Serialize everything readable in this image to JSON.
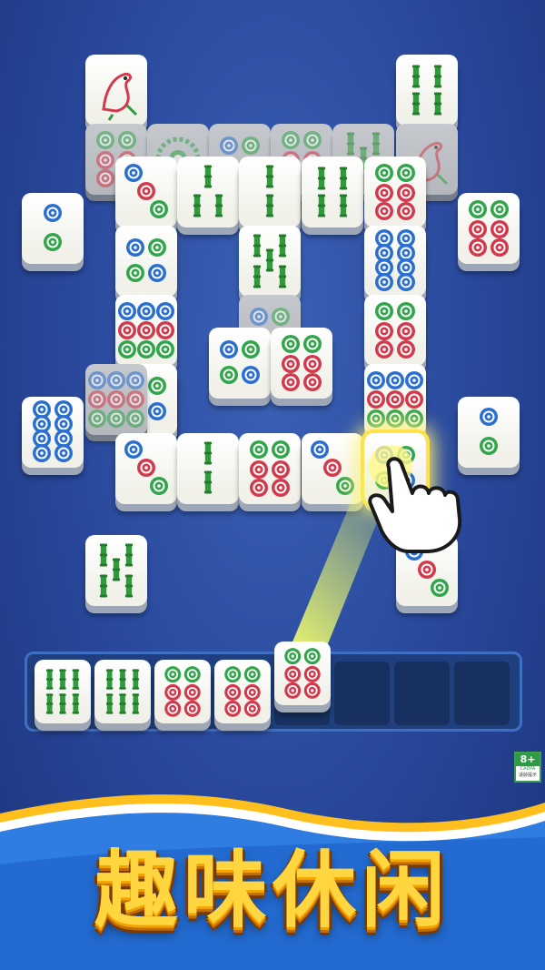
{
  "game": {
    "title": "趣味休闲",
    "age_rating": {
      "label": "8+",
      "org": "CADPA",
      "note": "适龄提示"
    }
  },
  "colors": {
    "bamboo": "#2f9b3a",
    "red": "#d23a4c",
    "blue": "#2a6fd0",
    "green": "#31a54a",
    "title": "#ffd640"
  },
  "board_tiles": [
    "bird",
    "bamboo-4",
    "circle-6",
    "flower",
    "circle-4",
    "circle-6",
    "bamboo-5",
    "bird",
    "circle-2",
    "circle-3",
    "bamboo-3",
    "bamboo-2",
    "bamboo-4",
    "circle-6",
    "circle-6",
    "circle-4",
    "bamboo-5",
    "circle-8",
    "circle-9",
    "circle-4",
    "circle-6",
    "circle-2",
    "circle-4",
    "circle-6",
    "circle-9",
    "circle-8",
    "circle-2",
    "circle-4",
    "circle-9",
    "circle-3",
    "bamboo-2",
    "circle-6",
    "circle-3",
    "circle-4",
    "bamboo-5",
    "circle-3"
  ],
  "tray": {
    "slots": 8,
    "tiles": [
      "bamboo-6",
      "bamboo-6",
      "circle-6",
      "circle-6"
    ],
    "incoming": "circle-6"
  }
}
